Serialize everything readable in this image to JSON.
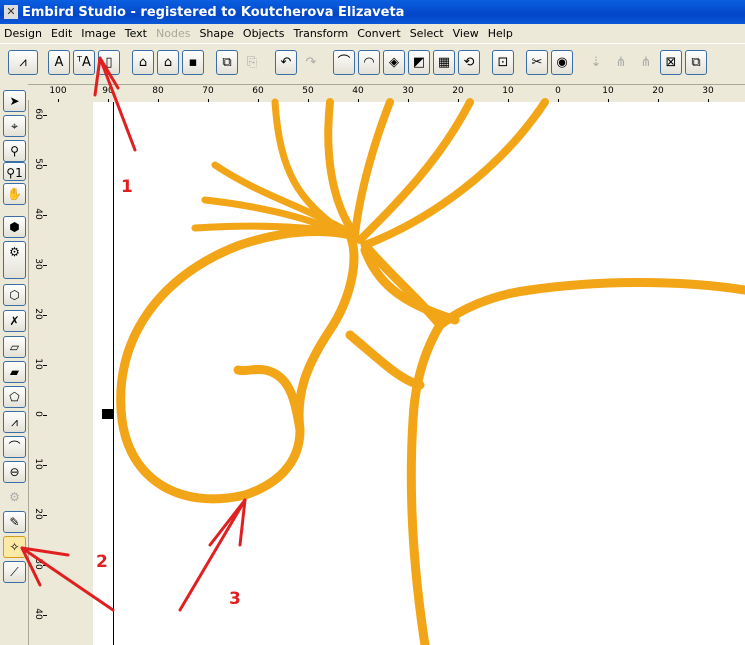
{
  "window": {
    "title": "Embird Studio - registered to Koutcherova Elizaveta"
  },
  "menu": [
    {
      "label": "Design",
      "enabled": true
    },
    {
      "label": "Edit",
      "enabled": true
    },
    {
      "label": "Image",
      "enabled": true
    },
    {
      "label": "Text",
      "enabled": true
    },
    {
      "label": "Nodes",
      "enabled": false
    },
    {
      "label": "Shape",
      "enabled": true
    },
    {
      "label": "Objects",
      "enabled": true
    },
    {
      "label": "Transform",
      "enabled": true
    },
    {
      "label": "Convert",
      "enabled": true
    },
    {
      "label": "Select",
      "enabled": true
    },
    {
      "label": "View",
      "enabled": true
    },
    {
      "label": "Help",
      "enabled": true
    }
  ],
  "rulers": {
    "horizontal": [
      "100",
      "90",
      "80",
      "70",
      "60",
      "50",
      "40",
      "30",
      "20",
      "10",
      "0",
      "10",
      "20",
      "30"
    ],
    "vertical": [
      "60",
      "50",
      "40",
      "30",
      "20",
      "10",
      "0",
      "10",
      "20",
      "30",
      "40"
    ]
  },
  "annotations": [
    "1",
    "2",
    "3"
  ],
  "colors": {
    "thread": "#f2a516",
    "arrow": "#e02020"
  }
}
